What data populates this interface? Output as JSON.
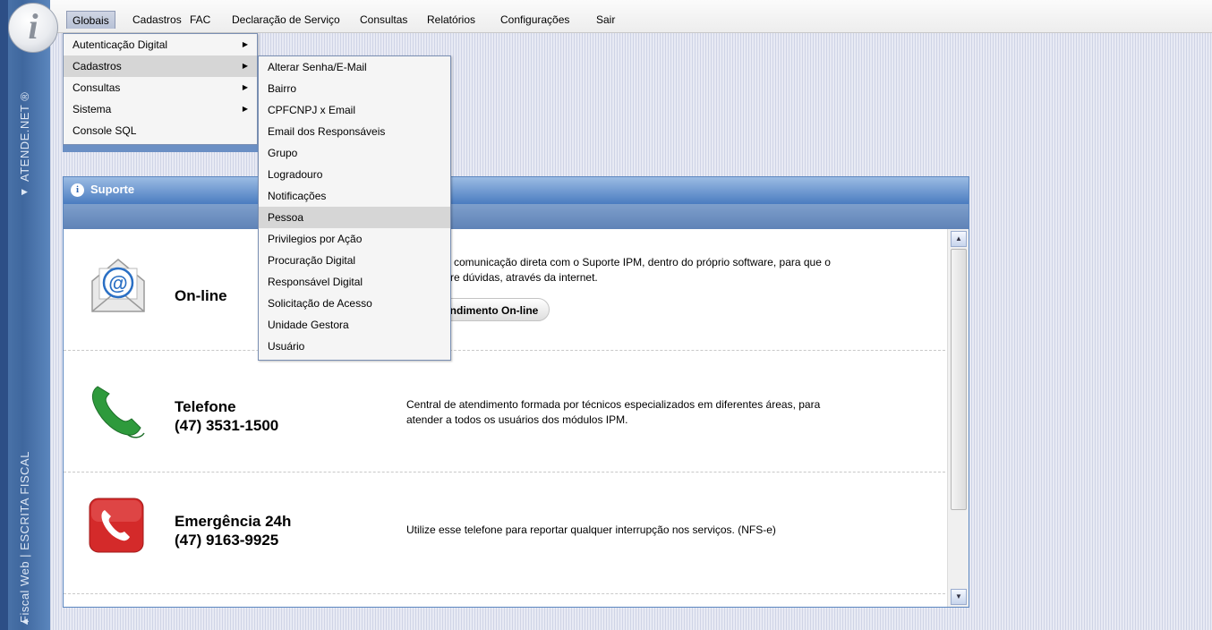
{
  "sidebar": {
    "logo_letter": "i",
    "top_label": "ATENDE.NET ®",
    "bottom_label": "Fiscal Web  |  ESCRITA FISCAL"
  },
  "menubar": {
    "items": [
      {
        "label": "Globais"
      },
      {
        "label": "Cadastros"
      },
      {
        "label": "FAC"
      },
      {
        "label": "Declaração de Serviço"
      },
      {
        "label": "Consultas"
      },
      {
        "label": "Relatórios"
      },
      {
        "label": "Configurações"
      },
      {
        "label": "Sair"
      }
    ]
  },
  "globais_menu": {
    "items": [
      {
        "label": "Autenticação Digital"
      },
      {
        "label": "Cadastros"
      },
      {
        "label": "Consultas"
      },
      {
        "label": "Sistema"
      },
      {
        "label": "Console SQL"
      }
    ]
  },
  "cadastros_submenu": {
    "items": [
      {
        "label": "Alterar Senha/E-Mail"
      },
      {
        "label": "Bairro"
      },
      {
        "label": "CPFCNPJ x Email"
      },
      {
        "label": "Email dos Responsáveis"
      },
      {
        "label": "Grupo"
      },
      {
        "label": "Logradouro"
      },
      {
        "label": "Notificações"
      },
      {
        "label": "Pessoa"
      },
      {
        "label": "Privilegios por Ação"
      },
      {
        "label": "Procuração Digital"
      },
      {
        "label": "Responsável Digital"
      },
      {
        "label": "Solicitação de Acesso"
      },
      {
        "label": "Unidade Gestora"
      },
      {
        "label": "Usuário"
      }
    ]
  },
  "panel": {
    "title": "Suporte",
    "info_icon_glyph": "i",
    "online": {
      "title": "On-line",
      "desc_line1": "e comunicação direta com o Suporte IPM, dentro do próprio software, para que o",
      "desc_line2": "tire dúvidas, através da internet.",
      "button": "endimento On-line"
    },
    "telefone": {
      "title": "Telefone",
      "number": "(47) 3531-1500",
      "desc_line1": "Central de atendimento formada por técnicos especializados em diferentes áreas, para",
      "desc_line2": "atender a todos os usuários dos módulos IPM."
    },
    "emergencia": {
      "title": "Emergência 24h",
      "number": "(47) 9163-9925",
      "desc": "Utilize esse telefone para reportar qualquer interrupção nos serviços. (NFS-e)"
    }
  },
  "colors": {
    "sidebar": "#3f679e",
    "panel_header": "#4a7cc0",
    "menu_highlight": "#d6d6d6",
    "phone_green": "#2e9a3c",
    "emergency_red": "#d42a2a"
  }
}
